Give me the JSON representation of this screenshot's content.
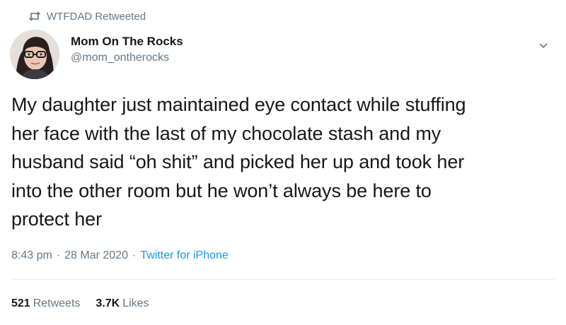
{
  "retweet": {
    "icon": "retweet-icon",
    "text": "WTFDAD Retweeted"
  },
  "author": {
    "avatar_icon": "avatar",
    "display_name": "Mom On The Rocks",
    "handle": "@mom_ontherocks",
    "menu_icon": "chevron-down-icon"
  },
  "tweet": {
    "text_lines": [
      "My daughter just maintained eye contact while stuffing",
      "her face with the last of my chocolate stash and my",
      "husband said “oh shit” and picked her up and took her",
      "into the other room but he won’t always be here to",
      "protect her"
    ]
  },
  "meta": {
    "time": "8:43 pm",
    "sep1": "·",
    "date": "28 Mar 2020",
    "sep2": "·",
    "source": "Twitter for iPhone"
  },
  "stats": {
    "retweets_count": "521",
    "retweets_label": "Retweets",
    "likes_count": "3.7K",
    "likes_label": "Likes"
  },
  "colors": {
    "text": "#14171a",
    "secondary": "#657786",
    "link": "#1b95e0",
    "divider": "#e6ecf0"
  }
}
